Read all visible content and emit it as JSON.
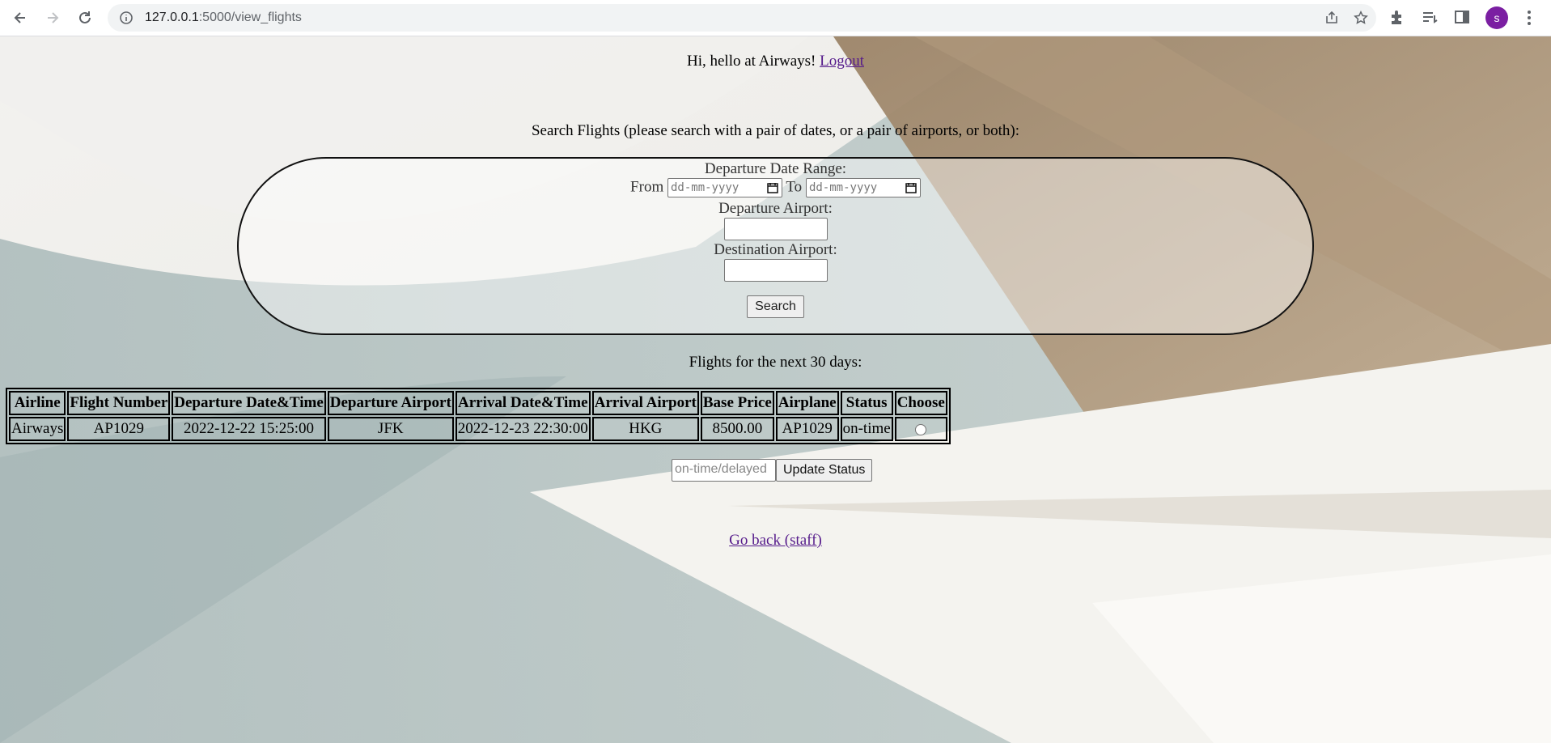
{
  "browser": {
    "url_host": "127.0.0.1",
    "url_path": ":5000/view_flights",
    "profile_initial": "s",
    "profile_color": "#7b1fa2"
  },
  "greeting": {
    "text": "Hi, hello at Airways!",
    "logout_label": "Logout"
  },
  "search": {
    "heading": "Search Flights (please search with a pair of dates, or a pair of airports, or both):",
    "date_range_label": "Departure Date Range:",
    "from_label": "From",
    "to_label": "To",
    "date_placeholder": "dd-mm-yyyy",
    "departure_airport_label": "Departure Airport:",
    "destination_airport_label": "Destination Airport:",
    "search_button": "Search"
  },
  "flights": {
    "heading": "Flights for the next 30 days:",
    "columns": [
      "Airline",
      "Flight Number",
      "Departure Date&Time",
      "Departure Airport",
      "Arrival Date&Time",
      "Arrival Airport",
      "Base Price",
      "Airplane",
      "Status",
      "Choose"
    ],
    "rows": [
      {
        "airline": "Airways",
        "flight_number": "AP1029",
        "departure_datetime": "2022-12-22 15:25:00",
        "departure_airport": "JFK",
        "arrival_datetime": "2022-12-23 22:30:00",
        "arrival_airport": "HKG",
        "base_price": "8500.00",
        "airplane": "AP1029",
        "status": "on-time"
      }
    ]
  },
  "status_update": {
    "placeholder": "on-time/delayed",
    "button": "Update Status"
  },
  "go_back": "Go back (staff)"
}
